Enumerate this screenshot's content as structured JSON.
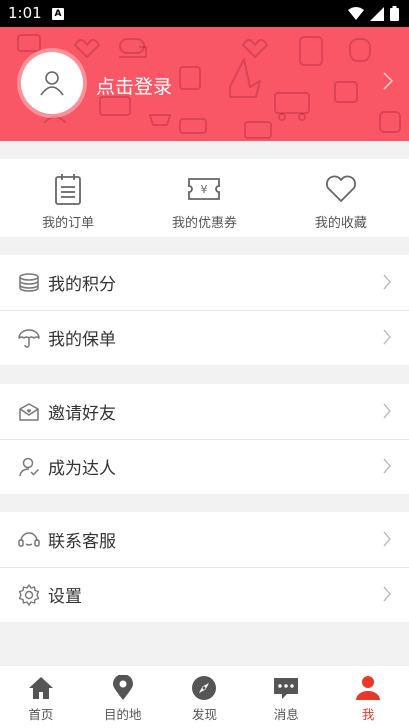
{
  "status": {
    "time": "1:01",
    "badge": "A"
  },
  "header": {
    "login_label": "点击登录"
  },
  "quick": [
    {
      "label": "我的订单",
      "icon": "clipboard-icon"
    },
    {
      "label": "我的优惠券",
      "icon": "coupon-icon"
    },
    {
      "label": "我的收藏",
      "icon": "heart-icon"
    }
  ],
  "groups": [
    [
      {
        "label": "我的积分",
        "icon": "coins-icon"
      },
      {
        "label": "我的保单",
        "icon": "umbrella-icon"
      }
    ],
    [
      {
        "label": "邀请好友",
        "icon": "invite-mail-icon"
      },
      {
        "label": "成为达人",
        "icon": "user-check-icon"
      }
    ],
    [
      {
        "label": "联系客服",
        "icon": "headset-icon"
      },
      {
        "label": "设置",
        "icon": "gear-icon"
      }
    ]
  ],
  "tabs": [
    {
      "label": "首页",
      "icon": "home-icon"
    },
    {
      "label": "目的地",
      "icon": "location-pin-icon"
    },
    {
      "label": "发现",
      "icon": "compass-icon"
    },
    {
      "label": "消息",
      "icon": "chat-icon"
    },
    {
      "label": "我",
      "icon": "person-icon",
      "active": true
    }
  ],
  "colors": {
    "header_bg": "#f95766",
    "active_tab": "#e8372b",
    "icon_gray": "#777777"
  }
}
